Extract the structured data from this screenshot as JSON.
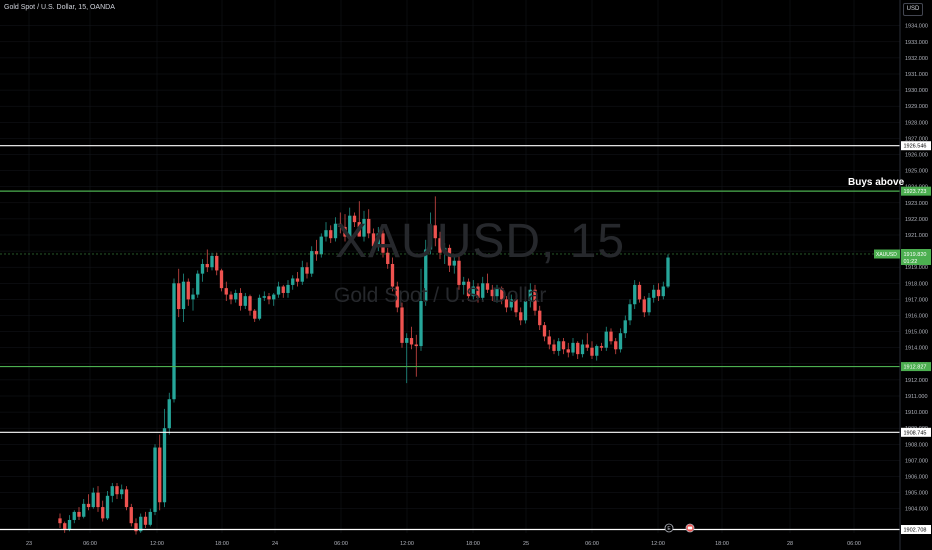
{
  "title_bar": "Gold Spot / U.S. Dollar, 15, OANDA",
  "currency": "USD",
  "watermark": {
    "symbol": "XAUUSD, 15",
    "name": "Gold Spot / U.S. Dollar"
  },
  "buys_label": "Buys above",
  "current_price": {
    "symbol": "XAUUSD",
    "price": "1919.820",
    "countdown": "01:22"
  },
  "colors": {
    "background": "#000000",
    "up": "#26a69a",
    "down": "#ef5350",
    "white_line": "#ffffff",
    "green_line": "#4caf50",
    "axis_text": "#b2b5be"
  },
  "chart_data": {
    "type": "candlestick",
    "title": "Gold Spot / U.S. Dollar, 15, OANDA",
    "ylim": [
      1902.3,
      1935.0
    ],
    "y_ticks": [
      "1904.000",
      "1905.000",
      "1906.000",
      "1907.000",
      "1908.000",
      "1909.000",
      "1910.000",
      "1911.000",
      "1912.000",
      "1913.000",
      "1914.000",
      "1915.000",
      "1916.000",
      "1917.000",
      "1918.000",
      "1919.000",
      "1920.000",
      "1921.000",
      "1922.000",
      "1923.000",
      "1924.000",
      "1925.000",
      "1926.000",
      "1927.000",
      "1928.000",
      "1929.000",
      "1930.000",
      "1931.000",
      "1932.000",
      "1933.000",
      "1934.000"
    ],
    "x_ticks": [
      "23",
      "06:00",
      "12:00",
      "18:00",
      "24",
      "06:00",
      "12:00",
      "18:00",
      "25",
      "06:00",
      "12:00",
      "18:00",
      "28",
      "06:00"
    ],
    "horizontal_levels": [
      {
        "price": 1926.546,
        "label": "1926.546",
        "color": "white"
      },
      {
        "price": 1923.723,
        "label": "1923.723",
        "color": "green"
      },
      {
        "price": 1912.827,
        "label": "1912.827",
        "color": "green"
      },
      {
        "price": 1908.745,
        "label": "1908.745",
        "color": "white"
      },
      {
        "price": 1902.708,
        "label": "1902.708",
        "color": "white"
      }
    ],
    "candles": [
      [
        1903.4,
        1903.7,
        1902.8,
        1903.1
      ],
      [
        1903.1,
        1903.2,
        1902.5,
        1902.7
      ],
      [
        1902.7,
        1903.6,
        1902.6,
        1903.3
      ],
      [
        1903.3,
        1903.9,
        1903.1,
        1903.8
      ],
      [
        1903.8,
        1904.1,
        1903.3,
        1903.5
      ],
      [
        1903.5,
        1904.6,
        1903.4,
        1904.3
      ],
      [
        1904.3,
        1904.9,
        1903.9,
        1904.1
      ],
      [
        1904.1,
        1905.3,
        1904.0,
        1905.0
      ],
      [
        1905.0,
        1905.4,
        1903.8,
        1904.1
      ],
      [
        1904.1,
        1904.5,
        1903.2,
        1903.4
      ],
      [
        1903.4,
        1905.1,
        1903.3,
        1904.8
      ],
      [
        1904.8,
        1905.6,
        1904.4,
        1905.4
      ],
      [
        1905.4,
        1905.6,
        1904.6,
        1904.9
      ],
      [
        1904.9,
        1905.5,
        1904.6,
        1905.2
      ],
      [
        1905.2,
        1905.4,
        1903.9,
        1904.1
      ],
      [
        1904.1,
        1904.3,
        1902.9,
        1903.1
      ],
      [
        1903.1,
        1903.4,
        1902.4,
        1902.6
      ],
      [
        1902.6,
        1903.7,
        1902.5,
        1903.5
      ],
      [
        1903.5,
        1903.8,
        1902.8,
        1903.0
      ],
      [
        1903.0,
        1904.0,
        1902.9,
        1903.8
      ],
      [
        1903.8,
        1908.0,
        1903.6,
        1907.8
      ],
      [
        1907.8,
        1908.6,
        1903.9,
        1904.4
      ],
      [
        1904.4,
        1910.2,
        1904.1,
        1909.0
      ],
      [
        1909.0,
        1911.2,
        1908.6,
        1910.8
      ],
      [
        1910.8,
        1918.3,
        1910.6,
        1918.0
      ],
      [
        1918.0,
        1918.9,
        1915.9,
        1916.4
      ],
      [
        1916.4,
        1918.6,
        1915.6,
        1918.1
      ],
      [
        1918.1,
        1918.3,
        1916.6,
        1917.0
      ],
      [
        1917.0,
        1917.7,
        1916.3,
        1917.3
      ],
      [
        1917.3,
        1918.8,
        1917.1,
        1918.6
      ],
      [
        1918.6,
        1919.5,
        1918.1,
        1919.2
      ],
      [
        1919.2,
        1920.1,
        1918.7,
        1919.0
      ],
      [
        1919.0,
        1919.9,
        1918.8,
        1919.7
      ],
      [
        1919.7,
        1919.9,
        1918.5,
        1918.8
      ],
      [
        1918.8,
        1918.9,
        1917.5,
        1917.7
      ],
      [
        1917.7,
        1918.1,
        1916.9,
        1917.3
      ],
      [
        1917.3,
        1917.5,
        1916.7,
        1917.0
      ],
      [
        1917.0,
        1917.6,
        1916.8,
        1917.4
      ],
      [
        1917.4,
        1917.7,
        1916.3,
        1916.6
      ],
      [
        1916.6,
        1917.4,
        1916.4,
        1917.2
      ],
      [
        1917.2,
        1917.3,
        1916.0,
        1916.3
      ],
      [
        1916.3,
        1916.4,
        1915.6,
        1915.8
      ],
      [
        1915.8,
        1917.3,
        1915.7,
        1917.1
      ],
      [
        1917.1,
        1917.5,
        1916.9,
        1917.2
      ],
      [
        1917.2,
        1917.4,
        1916.7,
        1917.0
      ],
      [
        1917.0,
        1917.4,
        1916.6,
        1917.3
      ],
      [
        1917.3,
        1918.1,
        1917.1,
        1917.8
      ],
      [
        1917.8,
        1917.9,
        1917.1,
        1917.4
      ],
      [
        1917.4,
        1918.2,
        1917.1,
        1917.9
      ],
      [
        1917.9,
        1918.5,
        1917.6,
        1918.3
      ],
      [
        1918.3,
        1918.7,
        1917.8,
        1918.1
      ],
      [
        1918.1,
        1919.4,
        1917.9,
        1919.0
      ],
      [
        1919.0,
        1919.3,
        1918.3,
        1918.6
      ],
      [
        1918.6,
        1920.3,
        1918.4,
        1920.0
      ],
      [
        1920.0,
        1920.7,
        1919.4,
        1919.8
      ],
      [
        1919.8,
        1921.1,
        1919.6,
        1920.9
      ],
      [
        1920.9,
        1921.8,
        1920.6,
        1921.3
      ],
      [
        1921.3,
        1921.6,
        1920.5,
        1920.8
      ],
      [
        1920.8,
        1922.1,
        1920.6,
        1921.7
      ],
      [
        1921.7,
        1922.4,
        1921.1,
        1921.5
      ],
      [
        1921.5,
        1922.3,
        1920.6,
        1920.9
      ],
      [
        1920.9,
        1922.7,
        1920.8,
        1922.2
      ],
      [
        1922.2,
        1922.4,
        1921.5,
        1921.8
      ],
      [
        1921.8,
        1923.1,
        1921.3,
        1920.9
      ],
      [
        1920.9,
        1922.5,
        1920.6,
        1922.0
      ],
      [
        1922.0,
        1922.6,
        1920.8,
        1921.1
      ],
      [
        1921.1,
        1921.4,
        1919.9,
        1920.3
      ],
      [
        1920.3,
        1921.5,
        1920.0,
        1921.1
      ],
      [
        1921.1,
        1921.3,
        1919.6,
        1919.9
      ],
      [
        1919.9,
        1920.2,
        1918.9,
        1919.2
      ],
      [
        1919.2,
        1919.6,
        1917.5,
        1917.8
      ],
      [
        1917.8,
        1918.1,
        1916.2,
        1916.5
      ],
      [
        1916.5,
        1916.8,
        1914.0,
        1914.3
      ],
      [
        1914.3,
        1914.9,
        1911.8,
        1914.6
      ],
      [
        1914.6,
        1915.3,
        1913.9,
        1914.2
      ],
      [
        1914.2,
        1914.8,
        1912.2,
        1914.1
      ],
      [
        1914.1,
        1918.9,
        1913.8,
        1916.9
      ],
      [
        1916.9,
        1920.7,
        1916.6,
        1920.1
      ],
      [
        1920.1,
        1922.4,
        1919.8,
        1921.6
      ],
      [
        1921.6,
        1923.4,
        1920.3,
        1920.8
      ],
      [
        1920.8,
        1921.2,
        1919.5,
        1919.9
      ],
      [
        1919.9,
        1920.5,
        1919.2,
        1920.2
      ],
      [
        1920.2,
        1920.4,
        1918.7,
        1919.1
      ],
      [
        1919.1,
        1919.8,
        1918.6,
        1919.4
      ],
      [
        1919.4,
        1919.7,
        1917.6,
        1917.9
      ],
      [
        1917.9,
        1918.4,
        1917.3,
        1918.1
      ],
      [
        1918.1,
        1918.3,
        1916.9,
        1917.2
      ],
      [
        1917.2,
        1918.2,
        1917.0,
        1917.8
      ],
      [
        1917.8,
        1918.0,
        1916.8,
        1917.1
      ],
      [
        1917.1,
        1918.4,
        1916.9,
        1918.0
      ],
      [
        1918.0,
        1918.6,
        1917.4,
        1917.6
      ],
      [
        1917.6,
        1917.9,
        1916.9,
        1917.2
      ],
      [
        1917.2,
        1917.9,
        1916.8,
        1917.7
      ],
      [
        1917.7,
        1917.8,
        1916.7,
        1917.0
      ],
      [
        1917.0,
        1917.2,
        1916.2,
        1916.5
      ],
      [
        1916.5,
        1917.3,
        1916.3,
        1917.0
      ],
      [
        1917.0,
        1917.4,
        1915.9,
        1916.2
      ],
      [
        1916.2,
        1916.5,
        1915.4,
        1915.7
      ],
      [
        1915.7,
        1917.5,
        1915.5,
        1916.9
      ],
      [
        1916.9,
        1918.0,
        1916.5,
        1917.6
      ],
      [
        1917.6,
        1917.9,
        1916.0,
        1916.3
      ],
      [
        1916.3,
        1916.6,
        1915.1,
        1915.4
      ],
      [
        1915.4,
        1915.6,
        1914.4,
        1914.7
      ],
      [
        1914.7,
        1915.1,
        1913.9,
        1914.2
      ],
      [
        1914.2,
        1914.5,
        1913.6,
        1913.8
      ],
      [
        1913.8,
        1914.6,
        1913.5,
        1914.4
      ],
      [
        1914.4,
        1914.6,
        1913.6,
        1913.9
      ],
      [
        1913.9,
        1914.3,
        1913.4,
        1913.7
      ],
      [
        1913.7,
        1914.6,
        1913.5,
        1914.3
      ],
      [
        1914.3,
        1914.4,
        1913.3,
        1913.6
      ],
      [
        1913.6,
        1914.5,
        1913.4,
        1914.2
      ],
      [
        1914.2,
        1914.9,
        1913.8,
        1914.0
      ],
      [
        1914.0,
        1914.4,
        1913.3,
        1913.5
      ],
      [
        1913.5,
        1914.2,
        1913.2,
        1914.1
      ],
      [
        1914.1,
        1914.3,
        1913.8,
        1914.0
      ],
      [
        1914.0,
        1915.3,
        1913.8,
        1915.0
      ],
      [
        1915.0,
        1915.2,
        1914.2,
        1914.4
      ],
      [
        1914.4,
        1914.6,
        1913.6,
        1913.9
      ],
      [
        1913.9,
        1915.2,
        1913.7,
        1914.9
      ],
      [
        1914.9,
        1916.0,
        1914.6,
        1915.7
      ],
      [
        1915.7,
        1917.0,
        1915.4,
        1916.7
      ],
      [
        1916.7,
        1918.2,
        1916.4,
        1917.9
      ],
      [
        1917.9,
        1918.1,
        1916.8,
        1917.0
      ],
      [
        1917.0,
        1917.2,
        1915.9,
        1916.2
      ],
      [
        1916.2,
        1917.4,
        1916.0,
        1917.1
      ],
      [
        1917.1,
        1917.9,
        1916.8,
        1917.6
      ],
      [
        1917.6,
        1918.0,
        1916.9,
        1917.2
      ],
      [
        1917.2,
        1918.1,
        1917.0,
        1917.8
      ],
      [
        1917.8,
        1919.8,
        1917.7,
        1919.6
      ]
    ]
  }
}
